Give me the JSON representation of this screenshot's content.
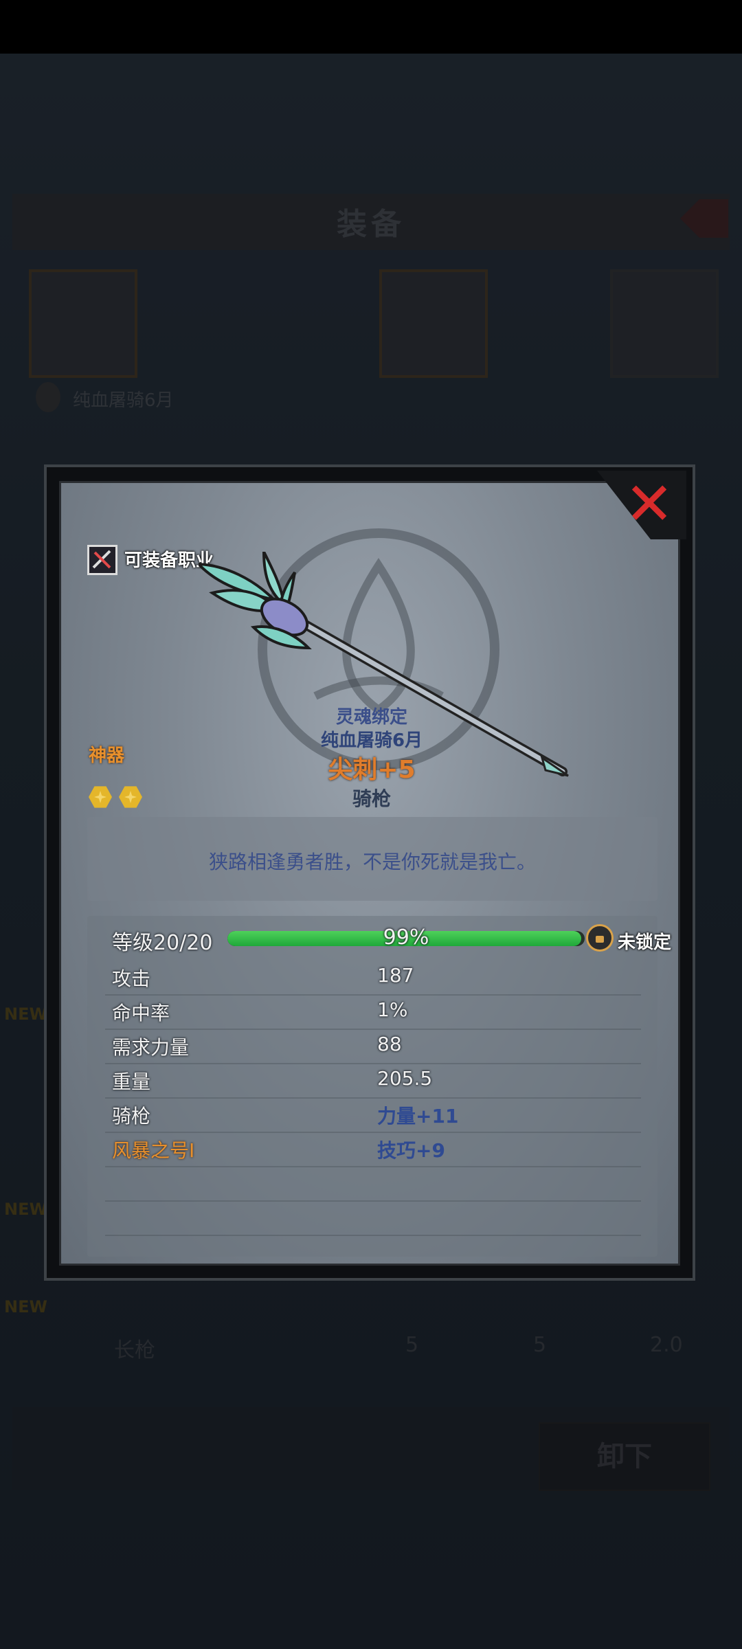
{
  "background": {
    "title": "装备",
    "owner": "纯血屠骑6月",
    "new_tags": [
      "NEW",
      "NEW",
      "NEW"
    ],
    "list_item": {
      "name": "长枪",
      "values": [
        "5",
        "5",
        "2.0"
      ]
    },
    "unequip_label": "卸下"
  },
  "dialog": {
    "class_label": "可装备职业",
    "rarity": "神器",
    "soulbound": "灵魂绑定",
    "owner": "纯血屠骑6月",
    "item_name": "尖刺",
    "item_plus": "+5",
    "item_type": "骑枪",
    "gem_count": 2,
    "quote": "狭路相逢勇者胜，不是你死就是我亡。",
    "level": {
      "label": "等级20/20",
      "percent_text": "99%",
      "progress": 0.99,
      "lock_label": "未锁定"
    },
    "stats": [
      {
        "name": "攻击",
        "value": "187"
      },
      {
        "name": "命中率",
        "value": "1%"
      },
      {
        "name": "需求力量",
        "value": "88"
      },
      {
        "name": "重量",
        "value": "205.5"
      }
    ],
    "bonuses": [
      {
        "name": "骑枪",
        "value": "力量+11"
      },
      {
        "name": "风暴之号I",
        "value": "技巧+9"
      }
    ],
    "colors": {
      "close": "#d82b2b",
      "rarity": "#e8902c",
      "progress": "#2fbf4a",
      "bonus_value": "#2f4a92"
    }
  }
}
